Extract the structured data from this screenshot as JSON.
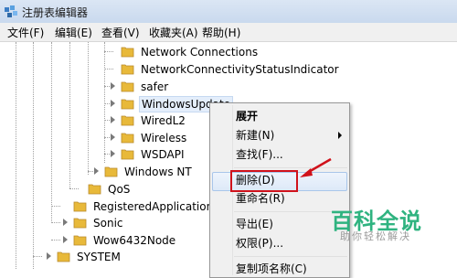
{
  "window": {
    "title": "注册表编辑器"
  },
  "menubar": [
    "文件(F)",
    "编辑(E)",
    "查看(V)",
    "收藏夹(A)",
    "帮助(H)"
  ],
  "tree": {
    "items": [
      "Network Connections",
      "NetworkConnectivityStatusIndicator",
      "safer",
      "WindowsUpdate",
      "WiredL2",
      "Wireless",
      "WSDAPI",
      "Windows NT",
      "QoS",
      "RegisteredApplications",
      "Sonic",
      "Wow6432Node",
      "SYSTEM"
    ]
  },
  "context_menu": {
    "items": [
      "展开",
      "新建(N)",
      "查找(F)...",
      "删除(D)",
      "重命名(R)",
      "导出(E)",
      "权限(P)...",
      "复制项名称(C)"
    ],
    "highlighted": "删除(D)",
    "has_submenu": "新建(N)"
  },
  "watermark": {
    "brand": "百科全说",
    "tagline": "助你轻松解决"
  },
  "colors": {
    "highlight_box": "#d0121b",
    "watermark": "#2fb380"
  }
}
